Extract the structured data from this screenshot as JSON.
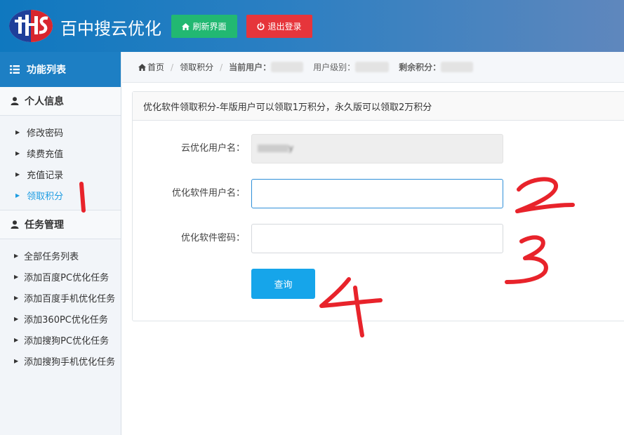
{
  "header": {
    "logo_icon": "brand-logo-icon",
    "title": "百中搜云优化",
    "refresh_label": "刷新界面",
    "logout_label": "退出登录",
    "refresh_color": "#22b872",
    "logout_color": "#e6353b"
  },
  "sidebar": {
    "title": "功能列表",
    "groups": [
      {
        "label": "个人信息",
        "items": [
          {
            "label": "修改密码",
            "active": false
          },
          {
            "label": "续费充值",
            "active": false
          },
          {
            "label": "充值记录",
            "active": false
          },
          {
            "label": "领取积分",
            "active": true
          }
        ]
      },
      {
        "label": "任务管理",
        "items": [
          {
            "label": "全部任务列表",
            "active": false
          },
          {
            "label": "添加百度PC优化任务",
            "active": false
          },
          {
            "label": "添加百度手机优化任务",
            "active": false
          },
          {
            "label": "添加360PC优化任务",
            "active": false
          },
          {
            "label": "添加搜狗PC优化任务",
            "active": false
          },
          {
            "label": "添加搜狗手机优化任务",
            "active": false
          }
        ]
      }
    ]
  },
  "breadcrumb": {
    "home": "首页",
    "current": "领取积分",
    "user_label": "当前用户：",
    "level_label": "用户级别：",
    "points_label": "剩余积分："
  },
  "panel": {
    "heading": "优化软件领取积分-年版用户可以领取1万积分，永久版可以领取2万积分",
    "fields": [
      {
        "label": "云优化用户名：",
        "value": "y",
        "placeholder": ""
      },
      {
        "label": "优化软件用户名：",
        "value": "",
        "placeholder": ""
      },
      {
        "label": "优化软件密码：",
        "value": "",
        "placeholder": ""
      }
    ],
    "submit_label": "查询"
  },
  "annotations": {
    "color": "#e8232b",
    "marks": [
      "1",
      "2",
      "3",
      "4"
    ]
  }
}
